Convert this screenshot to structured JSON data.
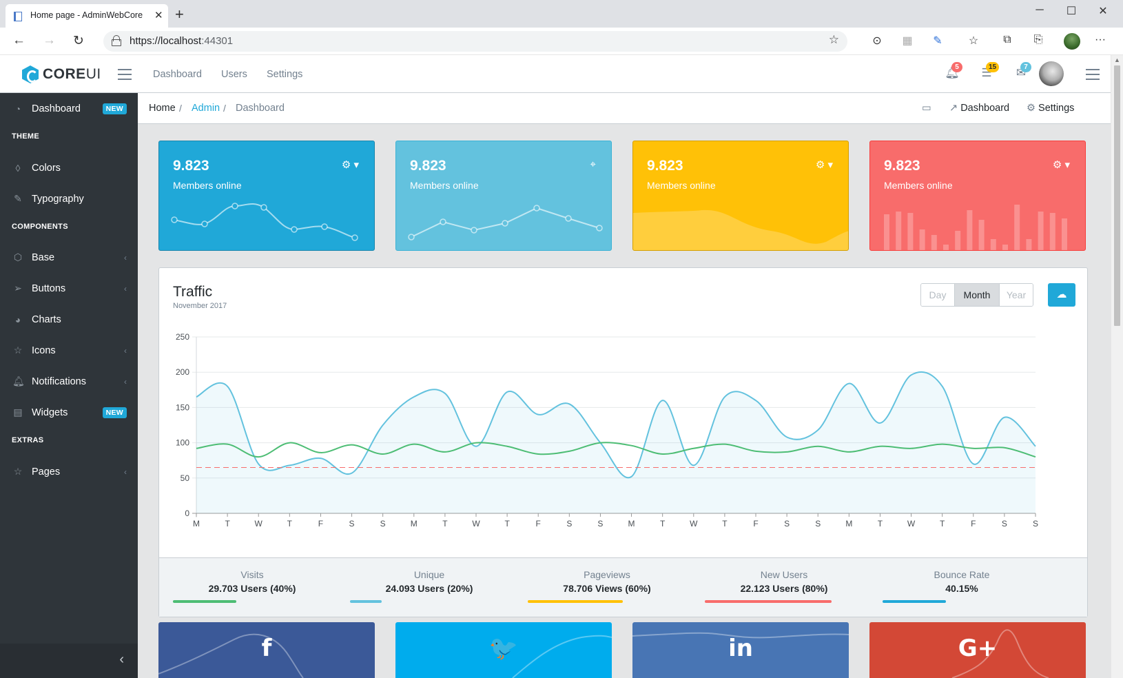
{
  "browser": {
    "tab_title": "Home page - AdminWebCore",
    "url_host": "https://localhost",
    "url_port": ":44301"
  },
  "header": {
    "brand_bold": "CORE",
    "brand_thin": "UI",
    "nav": [
      "Dashboard",
      "Users",
      "Settings"
    ],
    "badges": {
      "notifications": "5",
      "tasks": "15",
      "messages": "7"
    }
  },
  "sidebar": {
    "items": [
      {
        "label": "Dashboard",
        "badge": "NEW"
      },
      {
        "title": "THEME"
      },
      {
        "label": "Colors"
      },
      {
        "label": "Typography"
      },
      {
        "title": "COMPONENTS"
      },
      {
        "label": "Base"
      },
      {
        "label": "Buttons"
      },
      {
        "label": "Charts"
      },
      {
        "label": "Icons"
      },
      {
        "label": "Notifications"
      },
      {
        "label": "Widgets",
        "badge": "NEW"
      },
      {
        "title": "EXTRAS"
      },
      {
        "label": "Pages"
      }
    ]
  },
  "breadcrumb": {
    "items": [
      "Home",
      "Admin",
      "Dashboard"
    ],
    "right": [
      "Dashboard",
      "Settings"
    ]
  },
  "stat_cards": [
    {
      "value": "9.823",
      "label": "Members online",
      "color": "#20a8d8"
    },
    {
      "value": "9.823",
      "label": "Members online",
      "color": "#63c2de"
    },
    {
      "value": "9.823",
      "label": "Members online",
      "color": "#ffc107"
    },
    {
      "value": "9.823",
      "label": "Members online",
      "color": "#f86c6b"
    }
  ],
  "traffic": {
    "title": "Traffic",
    "subtitle": "November 2017",
    "buttons": [
      "Day",
      "Month",
      "Year"
    ],
    "active": "Month",
    "metrics": [
      {
        "title": "Visits",
        "value": "29.703 Users (40%)",
        "percent": 40,
        "color": "#4dbd74"
      },
      {
        "title": "Unique",
        "value": "24.093 Users (20%)",
        "percent": 20,
        "color": "#63c2de"
      },
      {
        "title": "Pageviews",
        "value": "78.706 Views (60%)",
        "percent": 60,
        "color": "#ffc107"
      },
      {
        "title": "New Users",
        "value": "22.123 Users (80%)",
        "percent": 80,
        "color": "#f86c6b"
      },
      {
        "title": "Bounce Rate",
        "value": "40.15%",
        "percent": 40,
        "color": "#20a8d8"
      }
    ]
  },
  "chart_data": {
    "type": "line",
    "categories": [
      "M",
      "T",
      "W",
      "T",
      "F",
      "S",
      "S",
      "M",
      "T",
      "W",
      "T",
      "F",
      "S",
      "S",
      "M",
      "T",
      "W",
      "T",
      "F",
      "S",
      "S",
      "M",
      "T",
      "W",
      "T",
      "F",
      "S",
      "S"
    ],
    "ylim": [
      0,
      250
    ],
    "yticks": [
      0,
      50,
      100,
      150,
      200,
      250
    ],
    "grid": true,
    "series": [
      {
        "values": [
          165,
          180,
          70,
          68,
          78,
          57,
          125,
          165,
          170,
          95,
          172,
          140,
          155,
          100,
          52,
          160,
          68,
          165,
          160,
          108,
          118,
          184,
          128,
          196,
          180,
          70,
          136,
          95
        ],
        "color": "#63c2de",
        "fill": true
      },
      {
        "values": [
          92,
          98,
          80,
          100,
          86,
          97,
          84,
          98,
          87,
          100,
          95,
          84,
          88,
          100,
          96,
          84,
          92,
          98,
          88,
          87,
          95,
          87,
          95,
          92,
          98,
          92,
          93,
          80
        ],
        "color": "#4dbd74",
        "fill": false
      },
      {
        "values": [
          65,
          65,
          65,
          65,
          65,
          65,
          65,
          65,
          65,
          65,
          65,
          65,
          65,
          65,
          65,
          65,
          65,
          65,
          65,
          65,
          65,
          65,
          65,
          65,
          65,
          65,
          65,
          65
        ],
        "color": "#f86c6b",
        "dashed": true
      }
    ]
  },
  "social": [
    {
      "glyph": "f",
      "color": "#3b5998"
    },
    {
      "glyph": "🐦",
      "color": "#00aced"
    },
    {
      "glyph": "in",
      "color": "#4875b4"
    },
    {
      "glyph": "G+",
      "color": "#d34836"
    }
  ]
}
